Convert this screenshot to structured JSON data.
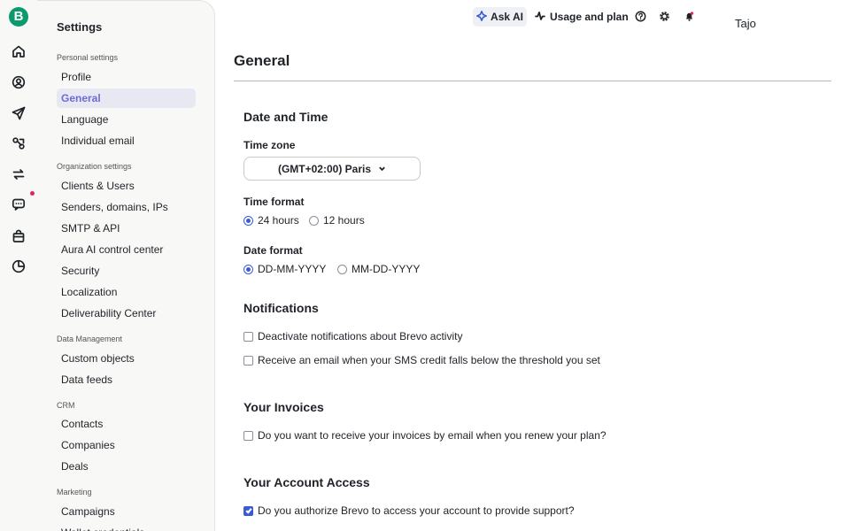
{
  "rail": {
    "logo_letter": "B",
    "icons": [
      "home-icon",
      "contacts-icon",
      "send-icon",
      "automation-icon",
      "sync-icon",
      "chat-icon",
      "shop-icon",
      "meetings-icon"
    ],
    "notification_color": "#e0245e"
  },
  "sidebar": {
    "title": "Settings",
    "groups": [
      {
        "label": "Personal settings",
        "items": [
          "Profile",
          "General",
          "Language",
          "Individual email"
        ]
      },
      {
        "label": "Organization settings",
        "items": [
          "Clients & Users",
          "Senders, domains, IPs",
          "SMTP & API",
          "Aura AI control center",
          "Security",
          "Localization",
          "Deliverability Center"
        ]
      },
      {
        "label": "Data Management",
        "items": [
          "Custom objects",
          "Data feeds"
        ]
      },
      {
        "label": "CRM",
        "items": [
          "Contacts",
          "Companies",
          "Deals"
        ]
      },
      {
        "label": "Marketing",
        "items": [
          "Campaigns",
          "Wallet credentials"
        ]
      }
    ],
    "active_item": "General"
  },
  "topbar": {
    "ask_ai": "Ask AI",
    "usage": "Usage and plan",
    "icons": [
      "help-icon",
      "gear-icon",
      "bell-icon"
    ],
    "user_name": "Tajo"
  },
  "main": {
    "page_title": "General",
    "date_time": {
      "title": "Date and Time",
      "timezone_label": "Time zone",
      "timezone_value": "(GMT+02:00) Paris",
      "time_format_label": "Time format",
      "time_format_options": [
        "24 hours",
        "12 hours"
      ],
      "time_format_selected": "24 hours",
      "date_format_label": "Date format",
      "date_format_options": [
        "DD-MM-YYYY",
        "MM-DD-YYYY"
      ],
      "date_format_selected": "DD-MM-YYYY"
    },
    "notifications": {
      "title": "Notifications",
      "options": [
        {
          "label": "Deactivate notifications about Brevo activity",
          "checked": false
        },
        {
          "label": "Receive an email when your SMS credit falls below the threshold you set",
          "checked": false
        }
      ]
    },
    "invoices": {
      "title": "Your Invoices",
      "options": [
        {
          "label": "Do you want to receive your invoices by email when you renew your plan?",
          "checked": false
        }
      ]
    },
    "account_access": {
      "title": "Your Account Access",
      "options": [
        {
          "label": "Do you authorize Brevo to access your account to provide support?",
          "checked": true
        }
      ]
    }
  },
  "colors": {
    "brand": "#0b996e",
    "accent": "#3a5bd9",
    "active_nav": "#6b6cd6"
  }
}
